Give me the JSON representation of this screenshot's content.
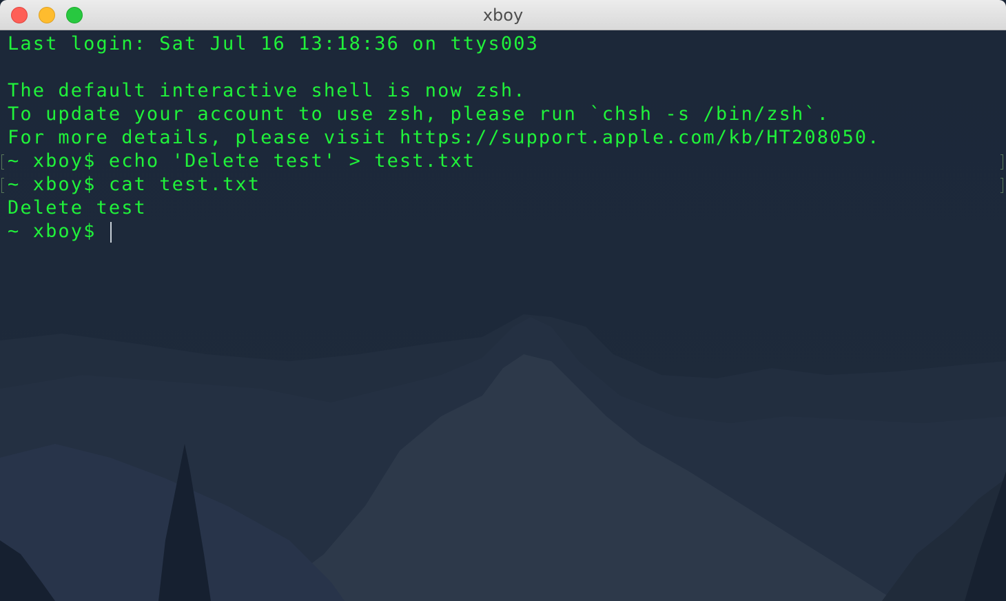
{
  "window": {
    "title": "xboy"
  },
  "terminal": {
    "lines": [
      "Last login: Sat Jul 16 13:18:36 on ttys003",
      "",
      "The default interactive shell is now zsh.",
      "To update your account to use zsh, please run `chsh -s /bin/zsh`.",
      "For more details, please visit https://support.apple.com/kb/HT208050.",
      "~ xboy$ echo 'Delete test' > test.txt",
      "~ xboy$ cat test.txt",
      "Delete test",
      "~ xboy$ "
    ],
    "text_color": "#20f23a",
    "background_color": "#1c2839"
  },
  "icons": {
    "close": "close-button-icon",
    "minimize": "minimize-button-icon",
    "zoom": "zoom-button-icon"
  }
}
